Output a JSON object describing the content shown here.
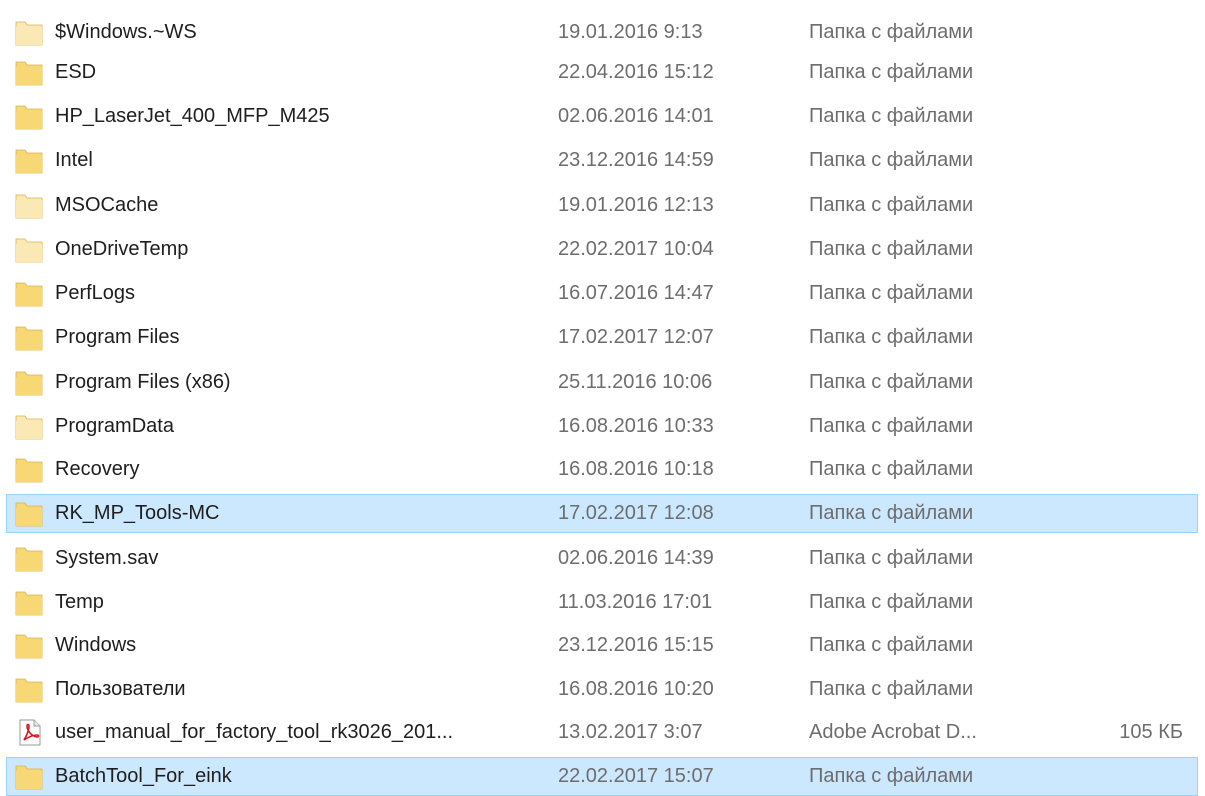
{
  "colors": {
    "folder": "#f8d775",
    "folder_light": "#fbe9b5",
    "selection_bg": "#cce8ff",
    "selection_border": "#99d1ff",
    "pdf_red": "#d71920"
  },
  "files": [
    {
      "name": "$Windows.~WS",
      "date": "19.01.2016 9:13",
      "type": "Папка с файлами",
      "size": "",
      "icon": "folder-hidden-icon",
      "selected": false
    },
    {
      "name": "ESD",
      "date": "22.04.2016 15:12",
      "type": "Папка с файлами",
      "size": "",
      "icon": "folder-icon",
      "selected": false
    },
    {
      "name": "HP_LaserJet_400_MFP_M425",
      "date": "02.06.2016 14:01",
      "type": "Папка с файлами",
      "size": "",
      "icon": "folder-icon",
      "selected": false
    },
    {
      "name": "Intel",
      "date": "23.12.2016 14:59",
      "type": "Папка с файлами",
      "size": "",
      "icon": "folder-icon",
      "selected": false
    },
    {
      "name": "MSOCache",
      "date": "19.01.2016 12:13",
      "type": "Папка с файлами",
      "size": "",
      "icon": "folder-hidden-icon",
      "selected": false
    },
    {
      "name": "OneDriveTemp",
      "date": "22.02.2017 10:04",
      "type": "Папка с файлами",
      "size": "",
      "icon": "folder-hidden-icon",
      "selected": false
    },
    {
      "name": "PerfLogs",
      "date": "16.07.2016 14:47",
      "type": "Папка с файлами",
      "size": "",
      "icon": "folder-icon",
      "selected": false
    },
    {
      "name": "Program Files",
      "date": "17.02.2017 12:07",
      "type": "Папка с файлами",
      "size": "",
      "icon": "folder-icon",
      "selected": false
    },
    {
      "name": "Program Files (x86)",
      "date": "25.11.2016 10:06",
      "type": "Папка с файлами",
      "size": "",
      "icon": "folder-icon",
      "selected": false
    },
    {
      "name": "ProgramData",
      "date": "16.08.2016 10:33",
      "type": "Папка с файлами",
      "size": "",
      "icon": "folder-hidden-icon",
      "selected": false
    },
    {
      "name": "Recovery",
      "date": "16.08.2016 10:18",
      "type": "Папка с файлами",
      "size": "",
      "icon": "folder-icon",
      "selected": false
    },
    {
      "name": "RK_MP_Tools-MC",
      "date": "17.02.2017 12:08",
      "type": "Папка с файлами",
      "size": "",
      "icon": "folder-icon",
      "selected": true
    },
    {
      "name": "System.sav",
      "date": "02.06.2016 14:39",
      "type": "Папка с файлами",
      "size": "",
      "icon": "folder-icon",
      "selected": false
    },
    {
      "name": "Temp",
      "date": "11.03.2016 17:01",
      "type": "Папка с файлами",
      "size": "",
      "icon": "folder-icon",
      "selected": false
    },
    {
      "name": "Windows",
      "date": "23.12.2016 15:15",
      "type": "Папка с файлами",
      "size": "",
      "icon": "folder-icon",
      "selected": false
    },
    {
      "name": "Пользователи",
      "date": "16.08.2016 10:20",
      "type": "Папка с файлами",
      "size": "",
      "icon": "folder-icon",
      "selected": false
    },
    {
      "name": "user_manual_for_factory_tool_rk3026_201...",
      "date": "13.02.2017 3:07",
      "type": "Adobe Acrobat D...",
      "size": "105 КБ",
      "icon": "pdf-file-icon",
      "selected": false
    },
    {
      "name": "BatchTool_For_eink",
      "date": "22.02.2017 15:07",
      "type": "Папка с файлами",
      "size": "",
      "icon": "folder-icon",
      "selected": true
    }
  ]
}
